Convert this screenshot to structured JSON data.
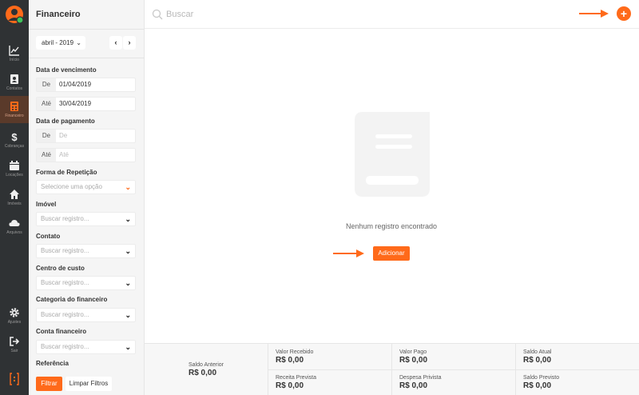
{
  "rail": {
    "items": [
      {
        "label": "Início",
        "icon": "chart-icon"
      },
      {
        "label": "Contatos",
        "icon": "contact-icon"
      },
      {
        "label": "Financeiro",
        "icon": "calculator-icon"
      },
      {
        "label": "Cobranças",
        "icon": "dollar-icon"
      },
      {
        "label": "Locações",
        "icon": "calendar-icon"
      },
      {
        "label": "Imóveis",
        "icon": "home-icon"
      },
      {
        "label": "Arquivos",
        "icon": "cloud-icon"
      },
      {
        "label": "Ajustes",
        "icon": "gear-icon"
      },
      {
        "label": "Sair",
        "icon": "logout-icon"
      }
    ],
    "active": "Financeiro"
  },
  "panel": {
    "title": "Financeiro",
    "month": "abril - 2019",
    "due_date": {
      "label": "Data de vencimento",
      "from_prefix": "De",
      "from_value": "01/04/2019",
      "to_prefix": "Até",
      "to_value": "30/04/2019"
    },
    "payment_date": {
      "label": "Data de pagamento",
      "from_prefix": "De",
      "from_placeholder": "De",
      "to_prefix": "Até",
      "to_placeholder": "Até"
    },
    "repetition": {
      "label": "Forma de Repetição",
      "placeholder": "Selecione uma opção"
    },
    "property": {
      "label": "Imóvel",
      "placeholder": "Buscar registro..."
    },
    "contact": {
      "label": "Contato",
      "placeholder": "Buscar registro..."
    },
    "cost_center": {
      "label": "Centro de custo",
      "placeholder": "Buscar registro..."
    },
    "category": {
      "label": "Categoria do financeiro",
      "placeholder": "Buscar registro..."
    },
    "account": {
      "label": "Conta financeiro",
      "placeholder": "Buscar registro..."
    },
    "reference": {
      "label": "Referência"
    },
    "filter_button": "Filtrar",
    "clear_button": "Limpar Filtros"
  },
  "topbar": {
    "search_placeholder": "Buscar"
  },
  "empty": {
    "message": "Nenhum registro encontrado",
    "add_button": "Adicionar"
  },
  "summary": {
    "previous_balance": {
      "label": "Saldo Anterior",
      "value": "R$ 0,00"
    },
    "received": {
      "label": "Valor Recebido",
      "value": "R$ 0,00"
    },
    "paid": {
      "label": "Valor Pago",
      "value": "R$ 0,00"
    },
    "current_balance": {
      "label": "Saldo Atual",
      "value": "R$ 0,00"
    },
    "expected_income": {
      "label": "Receita Prevista",
      "value": "R$ 0,00"
    },
    "expected_expense": {
      "label": "Despesa Privista",
      "value": "R$ 0,00"
    },
    "expected_balance": {
      "label": "Saldo Previsto",
      "value": "R$ 0,00"
    }
  },
  "colors": {
    "accent": "#ff6a1a",
    "rail_bg": "#2f3234",
    "panel_bg": "#f5f5f5"
  }
}
